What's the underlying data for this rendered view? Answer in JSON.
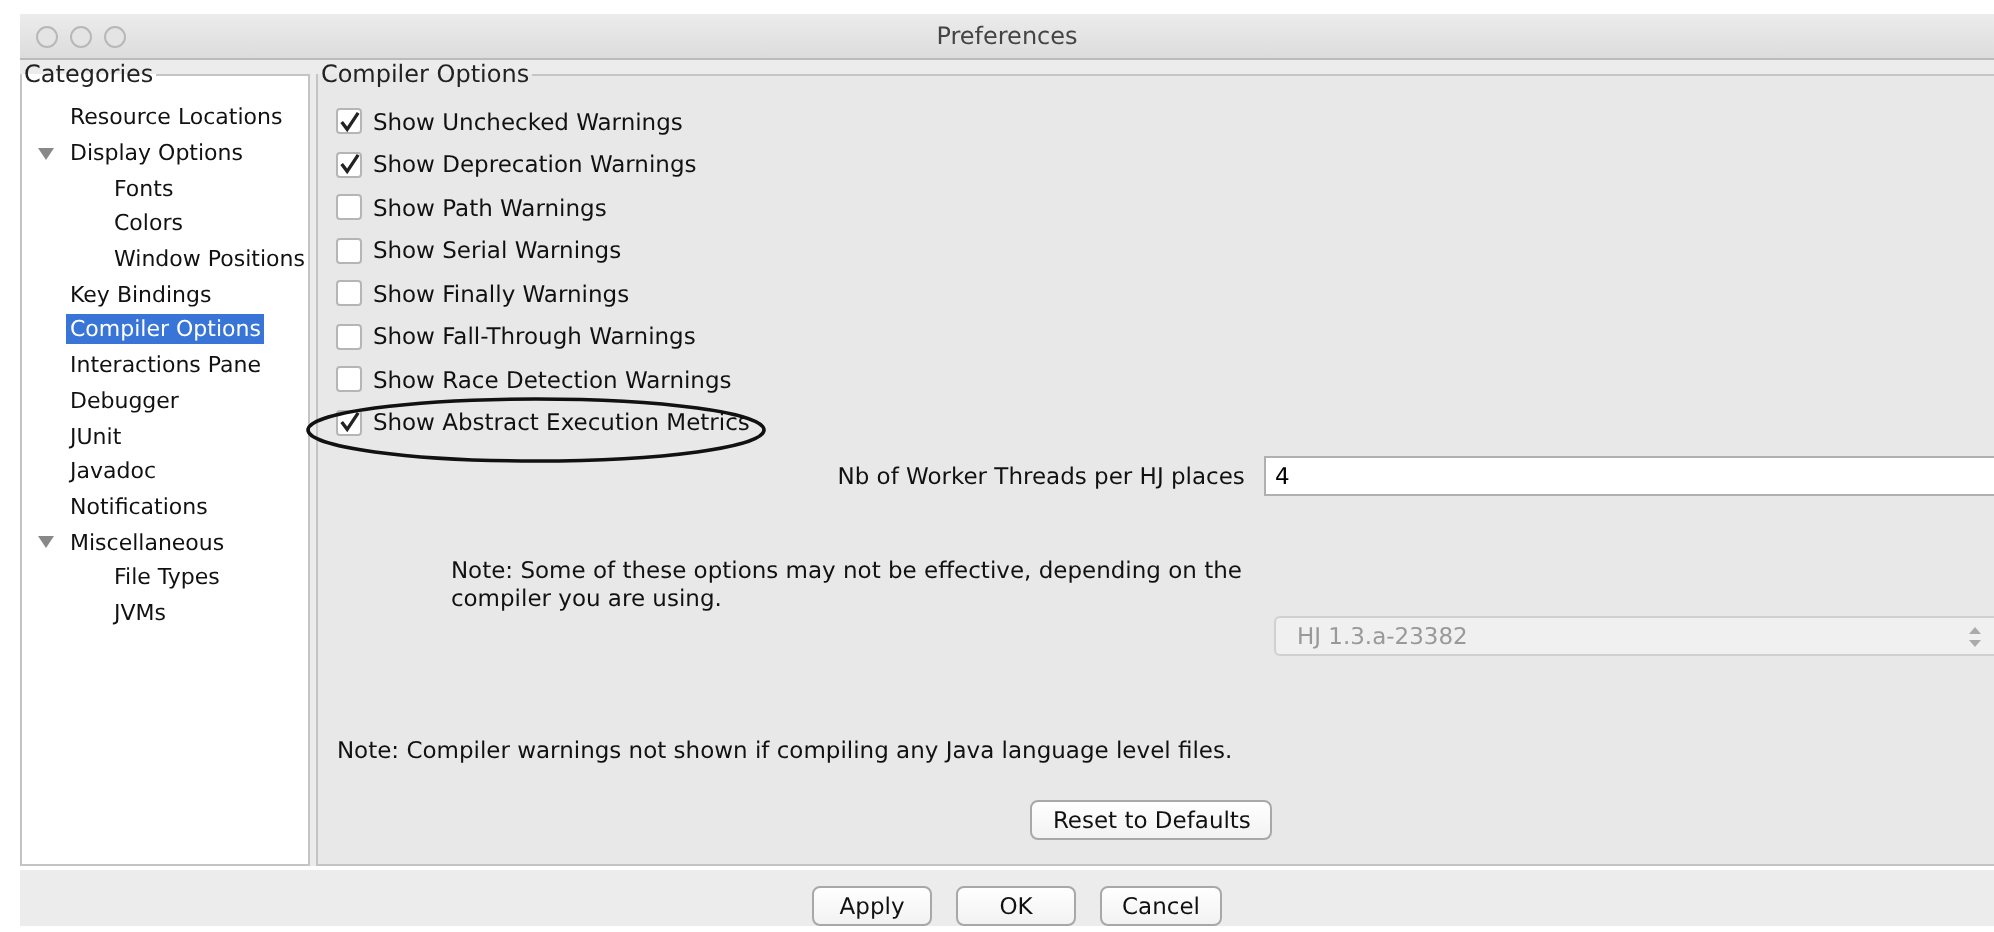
{
  "window": {
    "title": "Preferences"
  },
  "categories": {
    "title": "Categories",
    "items": [
      {
        "label": "Resource Locations",
        "selected": false
      },
      {
        "label": "Display Options",
        "selected": false,
        "expanded": true,
        "children": [
          {
            "label": "Fonts",
            "selected": false
          },
          {
            "label": "Colors",
            "selected": false
          },
          {
            "label": "Window Positions",
            "selected": false
          }
        ]
      },
      {
        "label": "Key Bindings",
        "selected": false
      },
      {
        "label": "Compiler Options",
        "selected": true
      },
      {
        "label": "Interactions Pane",
        "selected": false
      },
      {
        "label": "Debugger",
        "selected": false
      },
      {
        "label": "JUnit",
        "selected": false
      },
      {
        "label": "Javadoc",
        "selected": false
      },
      {
        "label": "Notifications",
        "selected": false
      },
      {
        "label": "Miscellaneous",
        "selected": false,
        "expanded": true,
        "children": [
          {
            "label": "File Types",
            "selected": false
          },
          {
            "label": "JVMs",
            "selected": false
          }
        ]
      }
    ]
  },
  "compiler_options": {
    "title": "Compiler Options",
    "options": [
      {
        "label": "Show Unchecked Warnings",
        "checked": true
      },
      {
        "label": "Show Deprecation Warnings",
        "checked": true
      },
      {
        "label": "Show Path Warnings",
        "checked": false
      },
      {
        "label": "Show Serial Warnings",
        "checked": false
      },
      {
        "label": "Show Finally Warnings",
        "checked": false
      },
      {
        "label": "Show Fall-Through Warnings",
        "checked": false
      },
      {
        "label": "Show Race Detection Warnings",
        "checked": false
      },
      {
        "label": "Show Abstract Execution Metrics",
        "checked": true
      }
    ],
    "threads": {
      "label": "Nb of Worker Threads per HJ places",
      "value": "4"
    },
    "note": "Note: Some of these options may not be effective, depending on the compiler you are using.",
    "compiler_select": {
      "value": "HJ 1.3.a-23382",
      "disabled": true
    },
    "warning_note": "Note: Compiler warnings not shown if compiling any Java language level files.",
    "reset_button": "Reset to Defaults"
  },
  "buttons": [
    "Apply",
    "OK",
    "Cancel"
  ]
}
